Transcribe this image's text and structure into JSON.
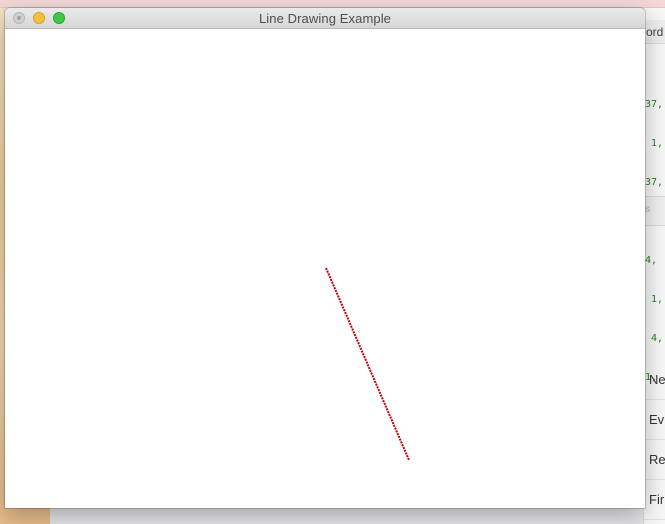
{
  "window": {
    "title": "Line Drawing Example"
  },
  "line": {
    "color": "#c40000",
    "style": "dashed"
  },
  "background_app": {
    "header_fragment": "ord",
    "code_lines": [
      "37,",
      " 1,",
      "37,",
      " 1,",
      "4,",
      " 1,",
      " 4,",
      "1,"
    ],
    "section_fragment": "s",
    "list_items": [
      "Ne",
      "Ev",
      "Re",
      "Fir"
    ]
  }
}
